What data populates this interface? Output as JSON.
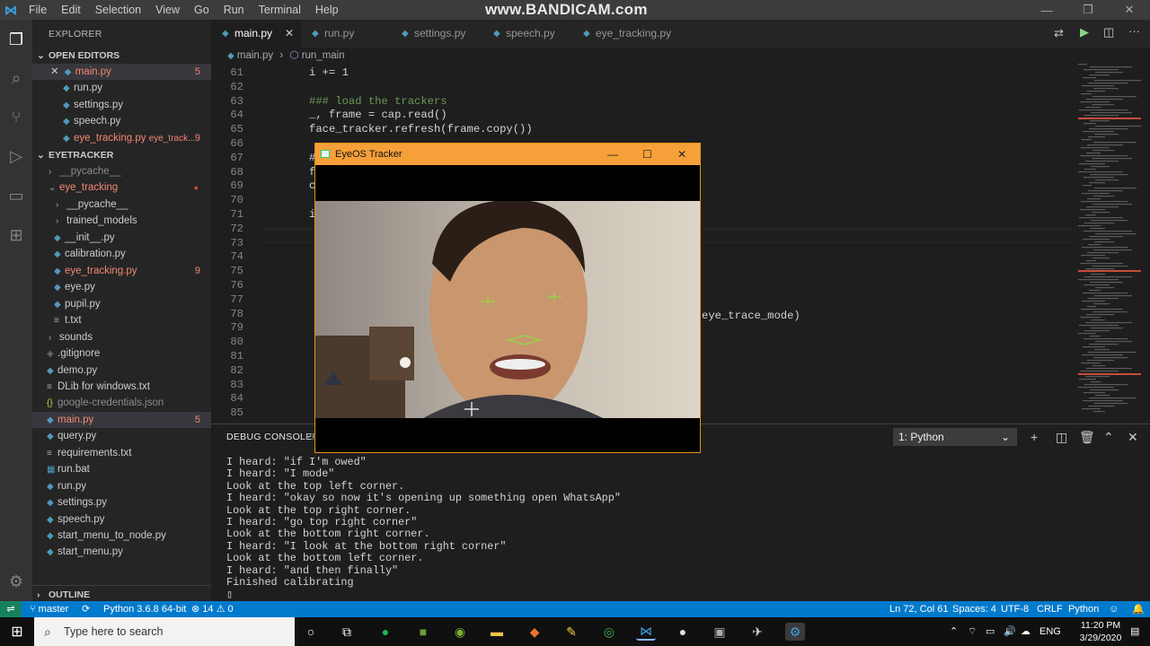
{
  "titlebar": {
    "menu": [
      "File",
      "Edit",
      "Selection",
      "View",
      "Go",
      "Run",
      "Terminal",
      "Help"
    ],
    "watermark": "www.BANDICAM.com"
  },
  "sidebar": {
    "header": "EXPLORER",
    "open_editors_label": "OPEN EDITORS",
    "open_editors": [
      {
        "name": "main.py",
        "badge": "5"
      },
      {
        "name": "run.py"
      },
      {
        "name": "settings.py"
      },
      {
        "name": "speech.py"
      },
      {
        "name": "eye_tracking.py",
        "hint": "eye_track...",
        "badge": "9"
      }
    ],
    "project_label": "EYETRACKER",
    "tree": [
      {
        "name": "__pycache__"
      },
      {
        "name": "eye_tracking"
      },
      {
        "name": "__pycache__"
      },
      {
        "name": "trained_models"
      },
      {
        "name": "__init__.py"
      },
      {
        "name": "calibration.py"
      },
      {
        "name": "eye_tracking.py",
        "badge": "9"
      },
      {
        "name": "eye.py"
      },
      {
        "name": "pupil.py"
      },
      {
        "name": "t.txt"
      },
      {
        "name": "sounds"
      },
      {
        "name": ".gitignore"
      },
      {
        "name": "demo.py"
      },
      {
        "name": "DLib for windows.txt"
      },
      {
        "name": "google-credentials.json"
      },
      {
        "name": "main.py",
        "badge": "5"
      },
      {
        "name": "query.py"
      },
      {
        "name": "requirements.txt"
      },
      {
        "name": "run.bat"
      },
      {
        "name": "run.py"
      },
      {
        "name": "settings.py"
      },
      {
        "name": "speech.py"
      },
      {
        "name": "start_menu_to_node.py"
      },
      {
        "name": "start_menu.py"
      }
    ],
    "outline_label": "OUTLINE"
  },
  "tabs": [
    "main.py",
    "run.py",
    "settings.py",
    "speech.py",
    "eye_tracking.py"
  ],
  "breadcrumb": {
    "file": "main.py",
    "symbol": "run_main"
  },
  "editor": {
    "line_numbers": [
      "61",
      "62",
      "63",
      "64",
      "65",
      "66",
      "67",
      "68",
      "69",
      "70",
      "71",
      "72",
      "73",
      "74",
      "75",
      "76",
      "77",
      "78",
      "79",
      "80",
      "81",
      "82",
      "83",
      "84",
      "85"
    ],
    "lines": [
      {
        "text": "i += 1"
      },
      {
        "text": ""
      },
      {
        "text": "### load the trackers",
        "comment": true
      },
      {
        "text": "_, frame = cap.read()"
      },
      {
        "text": "face_tracker.refresh(frame.copy())"
      },
      {
        "text": ""
      },
      {
        "text": "#"
      },
      {
        "text": "f"
      },
      {
        "text": "c"
      },
      {
        "text": ""
      },
      {
        "text": "i"
      }
    ],
    "line78_tail": "eye_trace_mode)"
  },
  "eyewin": {
    "title": "EyeOS Tracker"
  },
  "panel": {
    "tabs": [
      "DEBUG CONSOLE",
      "PR"
    ],
    "terminal_select": "1: Python",
    "output": [
      "I heard: \"if I'm owed\"",
      "I heard: \"I mode\"",
      "Look at the top left corner.",
      "I heard: \"okay so now it's opening up something open WhatsApp\"",
      "Look at the top right corner.",
      "I heard: \"go top right corner\"",
      "Look at the bottom right corner.",
      "I heard: \"I look at the bottom right corner\"",
      "Look at the bottom left corner.",
      "I heard: \"and then finally\"",
      "Finished calibrating",
      "▯"
    ]
  },
  "status": {
    "branch": "master",
    "interpreter": "Python 3.6.8 64-bit",
    "errors": "14",
    "warnings": "0",
    "position": "Ln 72, Col 61",
    "spaces": "Spaces: 4",
    "encoding": "UTF-8",
    "eol": "CRLF",
    "language": "Python"
  },
  "taskbar": {
    "search_placeholder": "Type here to search",
    "lang": "ENG",
    "time": "11:20 PM",
    "date": "3/29/2020"
  }
}
